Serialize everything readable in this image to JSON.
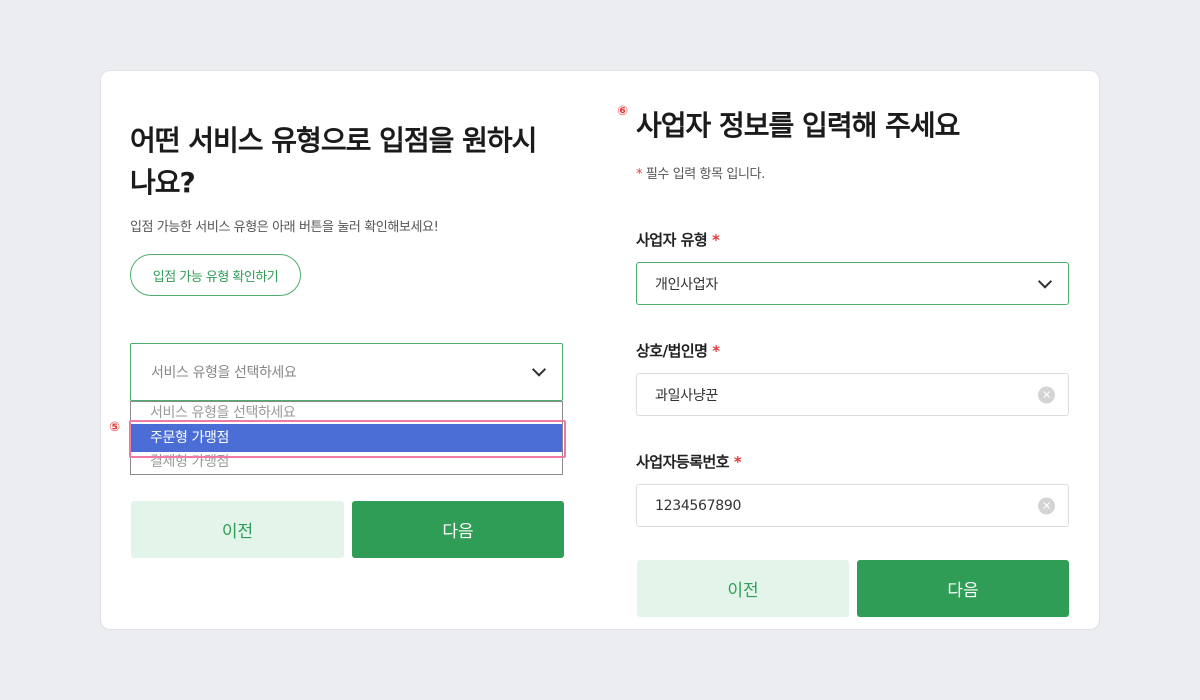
{
  "left": {
    "title": "어떤 서비스 유형으로 입점을 원하시나요?",
    "subtitle": "입점 가능한 서비스 유형은 아래 버튼을 눌러 확인해보세요!",
    "check_button": "입점 가능 유형 확인하기",
    "select_placeholder": "서비스 유형을 선택하세요",
    "dropdown_options": [
      "서비스 유형을 선택하세요",
      "주문형 가맹점",
      "결제형 가맹점"
    ],
    "marker": "⑤",
    "prev_label": "이전",
    "next_label": "다음"
  },
  "right": {
    "marker": "⑥",
    "title": "사업자 정보를 입력해 주세요",
    "required_note": "필수 입력 항목 입니다.",
    "required_star": "*",
    "fields": [
      {
        "label": "사업자 유형",
        "value": "개인사업자"
      },
      {
        "label": "상호/법인명",
        "value": "과일사냥꾼"
      },
      {
        "label": "사업자등록번호",
        "value": "1234567890"
      }
    ],
    "prev_label": "이전",
    "next_label": "다음"
  },
  "colors": {
    "accent": "#2f9d55",
    "accent_light": "#e3f5ea",
    "selected_option": "#4a6ed6",
    "highlight": "#ef7aa6",
    "required": "#e83b3b"
  },
  "icons": {
    "dropdown": "chevron-down-icon",
    "clear": "clear-icon"
  }
}
